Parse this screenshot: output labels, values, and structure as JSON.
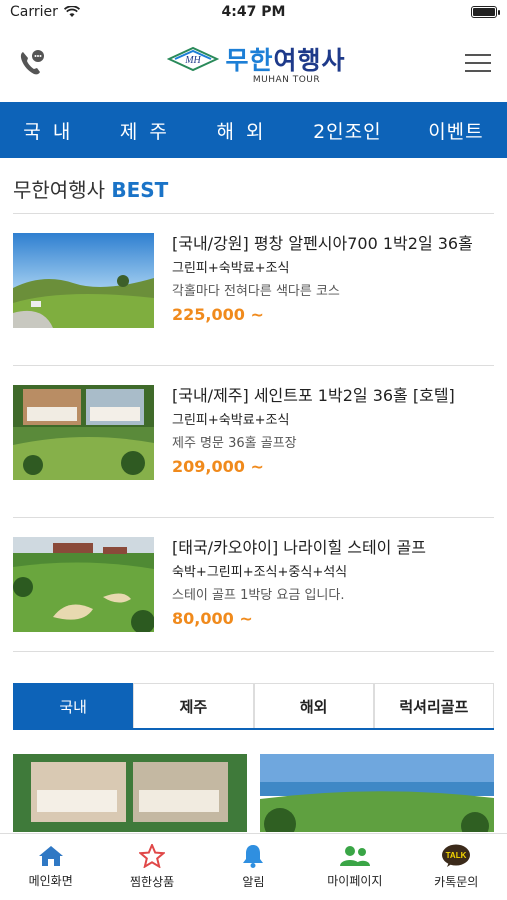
{
  "status": {
    "carrier": "Carrier",
    "time": "4:47 PM"
  },
  "header": {
    "logo_badge": "MH",
    "logo_main": "무한",
    "logo_main2": "여행사",
    "logo_sub": "MUHAN TOUR",
    "call_icon": "phone-chat-icon",
    "menu_icon": "hamburger-icon"
  },
  "nav": {
    "items": [
      "국 내",
      "제 주",
      "해 외",
      "2인조인",
      "이벤트"
    ]
  },
  "best": {
    "title_prefix": "무한여행사 ",
    "title_accent": "BEST",
    "products": [
      {
        "title": "[국내/강원] 평창 알펜시아700 1박2일 36홀",
        "sub": "그린피+숙박료+조식",
        "desc": "각홀마다 전혀다른 색다른 코스",
        "price": "225,000 ~"
      },
      {
        "title": "[국내/제주] 세인트포 1박2일 36홀 [호텔]",
        "sub": "그린피+숙박료+조식",
        "desc": "제주 명문 36홀 골프장",
        "price": "209,000 ~"
      },
      {
        "title": "[태국/카오야이] 나라이힐 스테이 골프",
        "sub": "숙박+그린피+조식+중식+석식",
        "desc": "스테이 골프 1박당 요금 입니다.",
        "price": "80,000 ~"
      }
    ]
  },
  "tabs": {
    "items": [
      "국내",
      "제주",
      "해외",
      "럭셔리골프"
    ],
    "active": "국내"
  },
  "bottom_nav": {
    "items": [
      {
        "label": "메인화면",
        "icon": "home-icon"
      },
      {
        "label": "찜한상품",
        "icon": "star-icon"
      },
      {
        "label": "알림",
        "icon": "bell-icon"
      },
      {
        "label": "마이페이지",
        "icon": "users-icon"
      },
      {
        "label": "카톡문의",
        "icon": "kakaotalk-icon",
        "badge": "TALK"
      }
    ]
  },
  "colors": {
    "primary": "#0d63b8",
    "accent": "#1a73c7",
    "price": "#f08a1c"
  }
}
